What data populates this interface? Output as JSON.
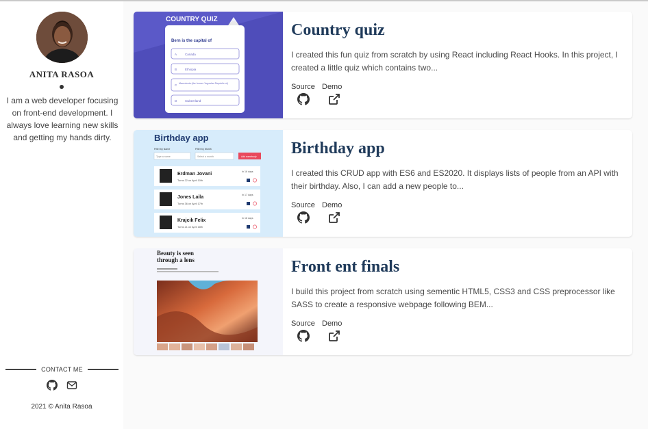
{
  "profile": {
    "name": "ANITA RASOA",
    "bio": "I am a web developer focusing on front-end development. I always love learning new skills and getting my hands dirty."
  },
  "contact": {
    "label": "CONTACT ME",
    "icons": [
      "github-icon",
      "mail-icon"
    ]
  },
  "footer": {
    "copyright": "2021 © Anita Rasoa"
  },
  "projects": [
    {
      "title": "Country quiz",
      "description": "I created this fun quiz from scratch by using React including React Hooks. In this project, I created a little quiz which contains two...",
      "source_label": "Source",
      "demo_label": "Demo",
      "preview": {
        "heading": "COUNTRY QUIZ",
        "question": "Bern is the capital of",
        "options": [
          {
            "letter": "A",
            "text": "Canada"
          },
          {
            "letter": "B",
            "text": "Ethiopia"
          },
          {
            "letter": "C",
            "text": "Macedonia (the former Yugoslav Republic of)"
          },
          {
            "letter": "D",
            "text": "Switzerland"
          }
        ]
      }
    },
    {
      "title": "Birthday app",
      "description": "I created this CRUD app with ES6 and ES2020. It displays lists of people from an API with their birthday. Also, I can add a new people to...",
      "source_label": "Source",
      "demo_label": "Demo",
      "preview": {
        "heading": "Birthday app",
        "filter_name": "Filter by Name",
        "filter_month": "Filter by Month",
        "search_placeholder": "Type a name",
        "month_placeholder": "Select a month",
        "add_button": "Add somebody",
        "people": [
          {
            "name": "Erdman Jovani",
            "turns": "Turns 22 on April 10th",
            "days": "In 16 days"
          },
          {
            "name": "Jones Laila",
            "turns": "Turns 36 on April 17th",
            "days": "In 17 days"
          },
          {
            "name": "Krajcik Felix",
            "turns": "Turns 21 on April 18th",
            "days": "In 18 days"
          }
        ]
      }
    },
    {
      "title": "Front ent finals",
      "description": "I build this project from scratch using sementic HTML5, CSS3 and CSS preprocessor like SASS to create a responsive webpage following BEM...",
      "source_label": "Source",
      "demo_label": "Demo",
      "preview": {
        "heading_line1": "Beauty is seen",
        "heading_line2": "through a lens"
      }
    }
  ],
  "colors": {
    "title": "#1f3a5a",
    "quiz_bg": "#5b59c8",
    "birthday_bg": "#d7ecfb",
    "birthday_accent": "#e9495d"
  }
}
